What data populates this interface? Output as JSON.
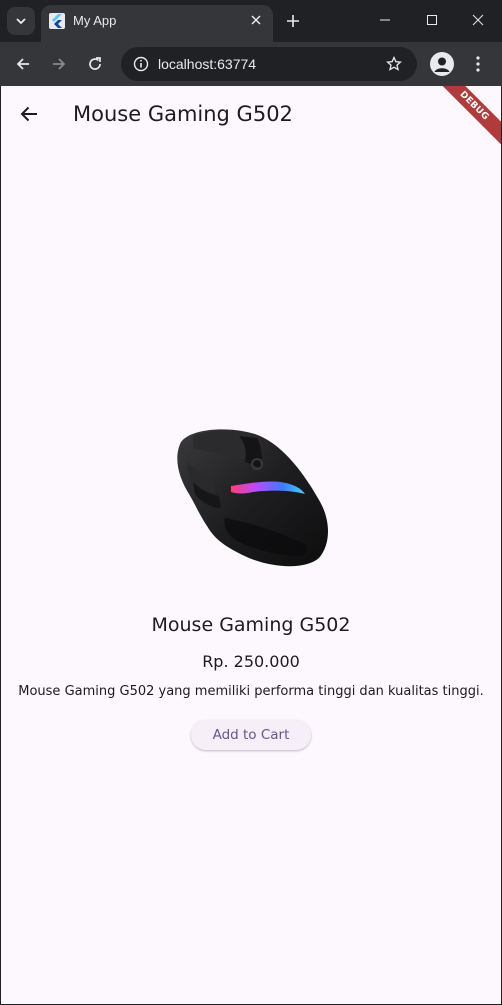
{
  "browser": {
    "tab_title": "My App",
    "url": "localhost:63774"
  },
  "app": {
    "appbar_title": "Mouse Gaming G502",
    "debug_label": "DEBUG",
    "product": {
      "name": "Mouse Gaming G502",
      "price": "Rp. 250.000",
      "description": "Mouse Gaming G502 yang memiliki performa tinggi dan kualitas tinggi.",
      "add_to_cart_label": "Add to Cart"
    }
  },
  "colors": {
    "app_background": "#fdf7fe",
    "button_text": "#65558f",
    "debug_banner": "#b13b3b"
  },
  "icons": [
    "tab-list-icon",
    "flutter-favicon-icon",
    "close-icon",
    "plus-icon",
    "minimize-icon",
    "maximize-icon",
    "back-arrow-icon",
    "forward-arrow-icon",
    "reload-icon",
    "info-icon",
    "star-icon",
    "profile-icon",
    "more-vert-icon"
  ]
}
